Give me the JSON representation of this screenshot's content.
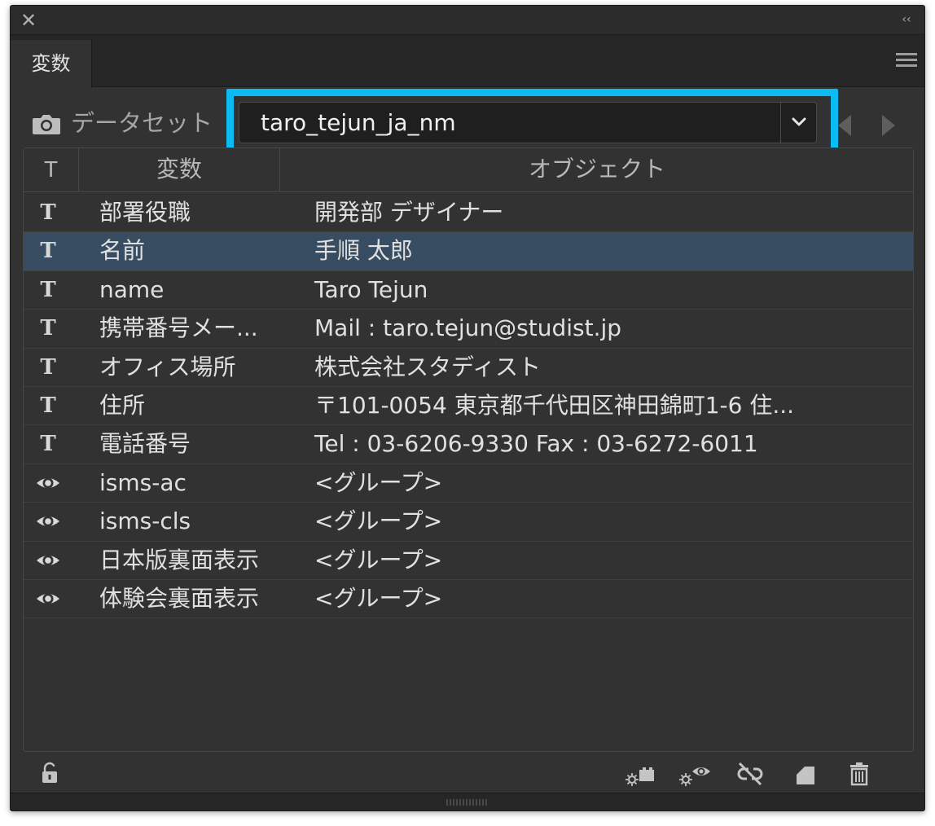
{
  "window": {
    "close_symbol": "✕",
    "collapse_symbol": "‹‹"
  },
  "tab": {
    "label": "変数"
  },
  "dataset": {
    "label": "データセット",
    "selected": "taro_tejun_ja_nm",
    "highlight_color": "#0bbbf2"
  },
  "table": {
    "headers": {
      "type": "T",
      "variable": "変数",
      "object": "オブジェクト"
    },
    "rows": [
      {
        "icon": "text-T-icon",
        "variable": "部署役職",
        "object": "開発部 デザイナー"
      },
      {
        "icon": "text-T-icon",
        "variable": "名前",
        "object": "手順 太郎",
        "selected": true
      },
      {
        "icon": "text-T-icon",
        "variable": "name",
        "object": "Taro Tejun"
      },
      {
        "icon": "text-T-icon",
        "variable": "携帯番号メー...",
        "object": "Mail : taro.tejun@studist.jp"
      },
      {
        "icon": "text-T-icon",
        "variable": "オフィス場所",
        "object": "株式会社スタディスト"
      },
      {
        "icon": "text-T-icon",
        "variable": "住所",
        "object": "〒101-0054 東京都千代田区神田錦町1-6 住..."
      },
      {
        "icon": "text-T-icon",
        "variable": "電話番号",
        "object": "Tel : 03-6206-9330     Fax : 03-6272-6011"
      },
      {
        "icon": "eye-icon",
        "variable": "isms-ac",
        "object": "<グループ>"
      },
      {
        "icon": "eye-icon",
        "variable": "isms-cls",
        "object": "<グループ>"
      },
      {
        "icon": "eye-icon",
        "variable": "日本版裏面表示",
        "object": "<グループ>"
      },
      {
        "icon": "eye-icon",
        "variable": "体験会裏面表示",
        "object": "<グループ>"
      }
    ]
  },
  "colors": {
    "panel_bg": "#323232",
    "selected_row": "#384d62",
    "text": "#e0e0e0"
  }
}
